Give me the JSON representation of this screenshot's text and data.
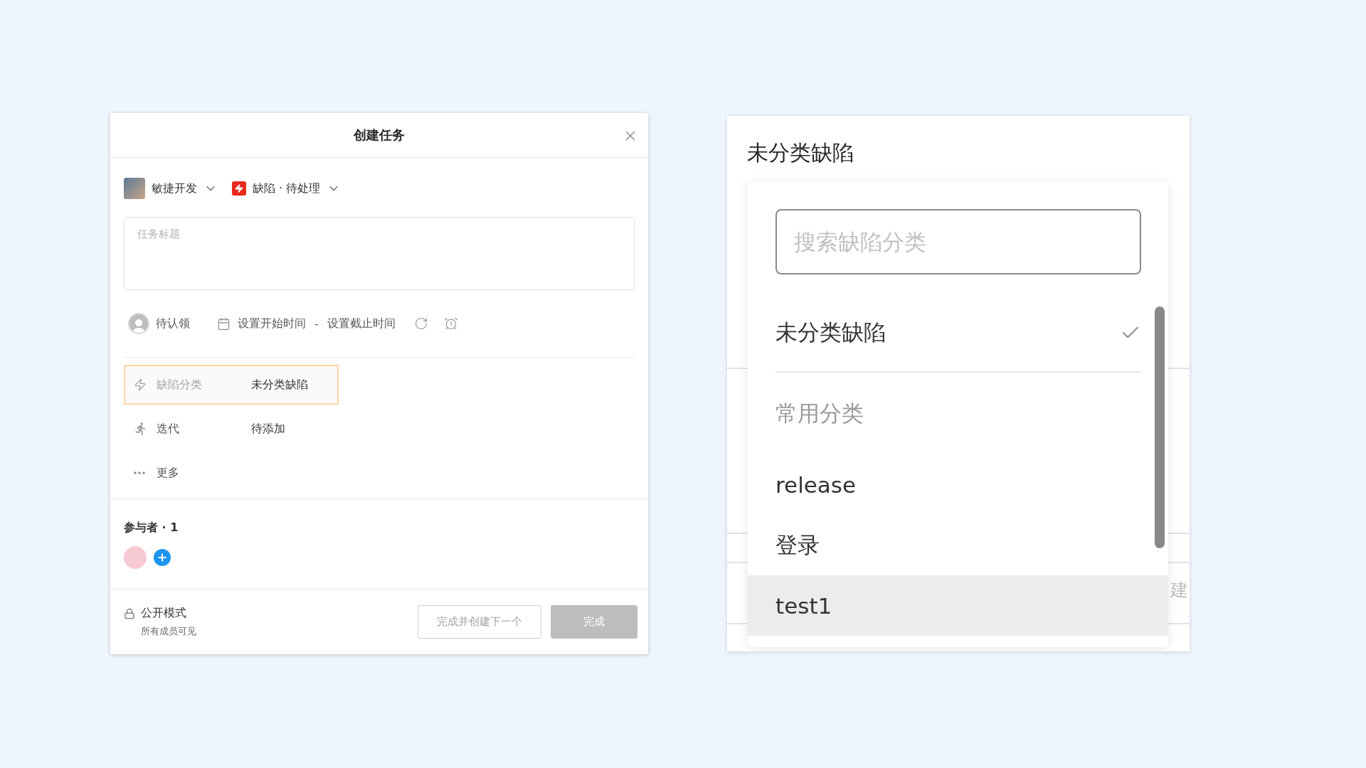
{
  "dialog": {
    "title": "创建任务",
    "project": {
      "name": "敏捷开发"
    },
    "task_type": {
      "label": "缺陷 · 待处理"
    },
    "title_field": {
      "placeholder": "任务标题"
    },
    "assignee": "待认领",
    "schedule": {
      "start": "设置开始时间",
      "separator": "-",
      "end": "设置截止时间"
    },
    "fields": [
      {
        "kind": "category",
        "label": "缺陷分类",
        "value": "未分类缺陷",
        "selected": true
      },
      {
        "kind": "iteration",
        "label": "迭代",
        "value": "待添加",
        "selected": false
      },
      {
        "kind": "more",
        "label": "更多",
        "selected": false
      }
    ],
    "participants": {
      "title": "参与者 · 1"
    },
    "visibility": {
      "label": "公开模式",
      "hint": "所有成员可见"
    },
    "buttons": [
      {
        "label": "完成并创建下一个",
        "kind": "secondary"
      },
      {
        "label": "完成",
        "kind": "primary",
        "disabled": true
      }
    ]
  },
  "zoom_panel": {
    "title": "未分类缺陷",
    "behind_text": "建",
    "dropdown": {
      "search": {
        "placeholder": "搜索缺陷分类"
      },
      "current": {
        "label": "未分类缺陷",
        "checked": true
      },
      "group": "常用分类",
      "options": [
        {
          "label": "release",
          "hovered": false
        },
        {
          "label": "登录",
          "hovered": false
        },
        {
          "label": "test1",
          "hovered": true
        }
      ]
    }
  }
}
